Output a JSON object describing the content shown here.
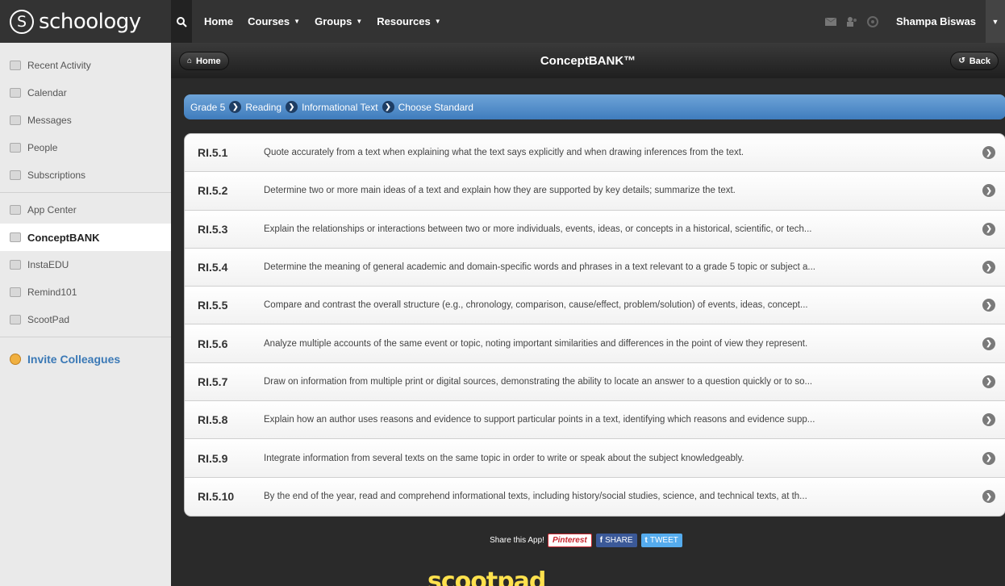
{
  "topnav": {
    "logo_s": "S",
    "logo_text": "schoology",
    "search_icon": "search-icon",
    "items": [
      {
        "label": "Home",
        "caret": ""
      },
      {
        "label": "Courses",
        "caret": "▼"
      },
      {
        "label": "Groups",
        "caret": "▼"
      },
      {
        "label": "Resources",
        "caret": "▼"
      }
    ],
    "user_name": "Shampa Biswas",
    "user_caret": "▼"
  },
  "sidebar": {
    "items": [
      {
        "label": "Recent Activity",
        "icon": "recent-activity-icon"
      },
      {
        "label": "Calendar",
        "icon": "calendar-icon"
      },
      {
        "label": "Messages",
        "icon": "messages-icon"
      },
      {
        "label": "People",
        "icon": "people-icon"
      },
      {
        "label": "Subscriptions",
        "icon": "subscriptions-icon"
      }
    ],
    "apps": [
      {
        "label": "App Center",
        "icon": "app-center-icon"
      },
      {
        "label": "ConceptBANK",
        "icon": "conceptbank-icon"
      },
      {
        "label": "InstaEDU",
        "icon": "instaedu-icon"
      },
      {
        "label": "Remind101",
        "icon": "remind101-icon"
      },
      {
        "label": "ScootPad",
        "icon": "scootpad-icon"
      }
    ],
    "invite": "Invite Colleagues"
  },
  "main": {
    "home_label": "Home",
    "title": "ConceptBANK™",
    "back_label": "Back",
    "breadcrumb": [
      "Grade 5",
      "Reading",
      "Informational Text",
      "Choose Standard"
    ],
    "standards": [
      {
        "code": "RI.5.1",
        "text": "Quote accurately from a text when explaining what the text says explicitly and when drawing inferences from the text."
      },
      {
        "code": "RI.5.2",
        "text": "Determine two or more main ideas of a text and explain how they are supported by key details; summarize the text."
      },
      {
        "code": "RI.5.3",
        "text": "Explain the relationships or interactions between two or more individuals, events, ideas, or concepts in a historical, scientific, or tech..."
      },
      {
        "code": "RI.5.4",
        "text": "Determine the meaning of general academic and domain-specific words and phrases in a text relevant to a grade 5 topic or subject a..."
      },
      {
        "code": "RI.5.5",
        "text": "Compare and contrast the overall structure (e.g., chronology, comparison, cause/effect, problem/solution) of events, ideas, concept..."
      },
      {
        "code": "RI.5.6",
        "text": "Analyze multiple accounts of the same event or topic, noting important similarities and differences in the point of view they represent."
      },
      {
        "code": "RI.5.7",
        "text": "Draw on information from multiple print or digital sources, demonstrating the ability to locate an answer to a question quickly or to so..."
      },
      {
        "code": "RI.5.8",
        "text": "Explain how an author uses reasons and evidence to support particular points in a text, identifying which reasons and evidence supp..."
      },
      {
        "code": "RI.5.9",
        "text": "Integrate information from several texts on the same topic in order to write or speak about the subject knowledgeably."
      },
      {
        "code": "RI.5.10",
        "text": "By the end of the year, read and comprehend informational texts, including history/social studies, science, and technical texts, at th..."
      }
    ],
    "share_label": "Share this App!",
    "share_pinterest": "Pinterest",
    "share_facebook": "SHARE",
    "share_twitter": "TWEET",
    "footer_logo": "scootpad"
  }
}
